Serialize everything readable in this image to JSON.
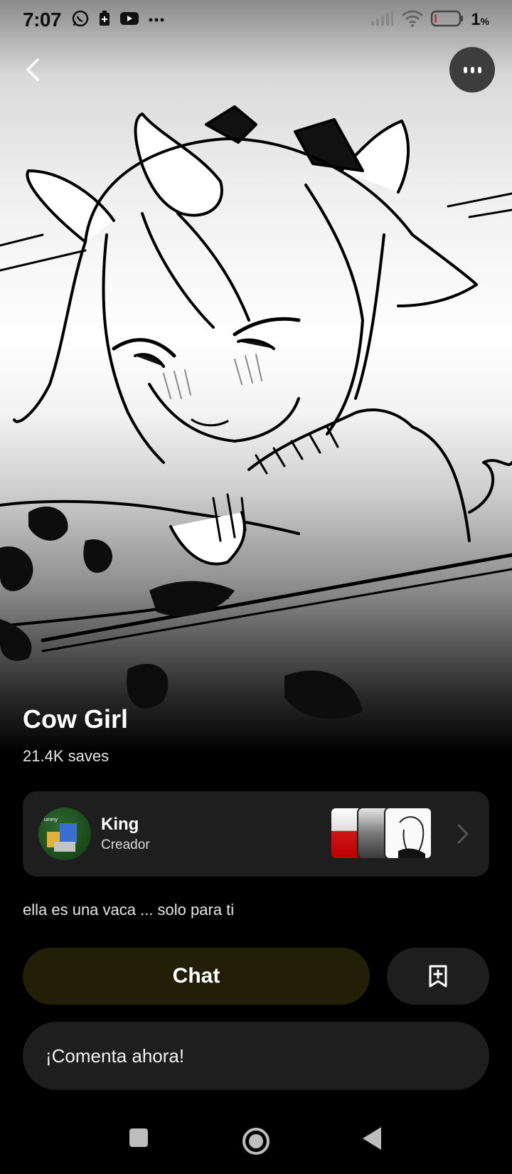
{
  "status_bar": {
    "time": "7:07",
    "battery_percent": "1",
    "battery_suffix": "%",
    "icons": [
      "whatsapp-icon",
      "battery-saver-icon",
      "youtube-icon",
      "more-notifications-icon",
      "signal-icon",
      "wifi-icon",
      "battery-icon"
    ]
  },
  "header": {
    "back_icon": "chevron-left-icon",
    "more_icon": "more-vertical-icon"
  },
  "character": {
    "name": "Cow Girl",
    "saves": "21.4K saves",
    "description": "ella es una vaca ... solo para ti"
  },
  "creator": {
    "name": "King",
    "role": "Creador",
    "avatar_text": "ummy"
  },
  "actions": {
    "chat_label": "Chat",
    "save_icon": "bookmark-plus-icon"
  },
  "comment": {
    "placeholder": "¡Comenta ahora!"
  },
  "colors": {
    "background": "#000000",
    "card": "#1e1e1e",
    "chat_button": "#231f06",
    "more_button": "#3d3d3d"
  }
}
